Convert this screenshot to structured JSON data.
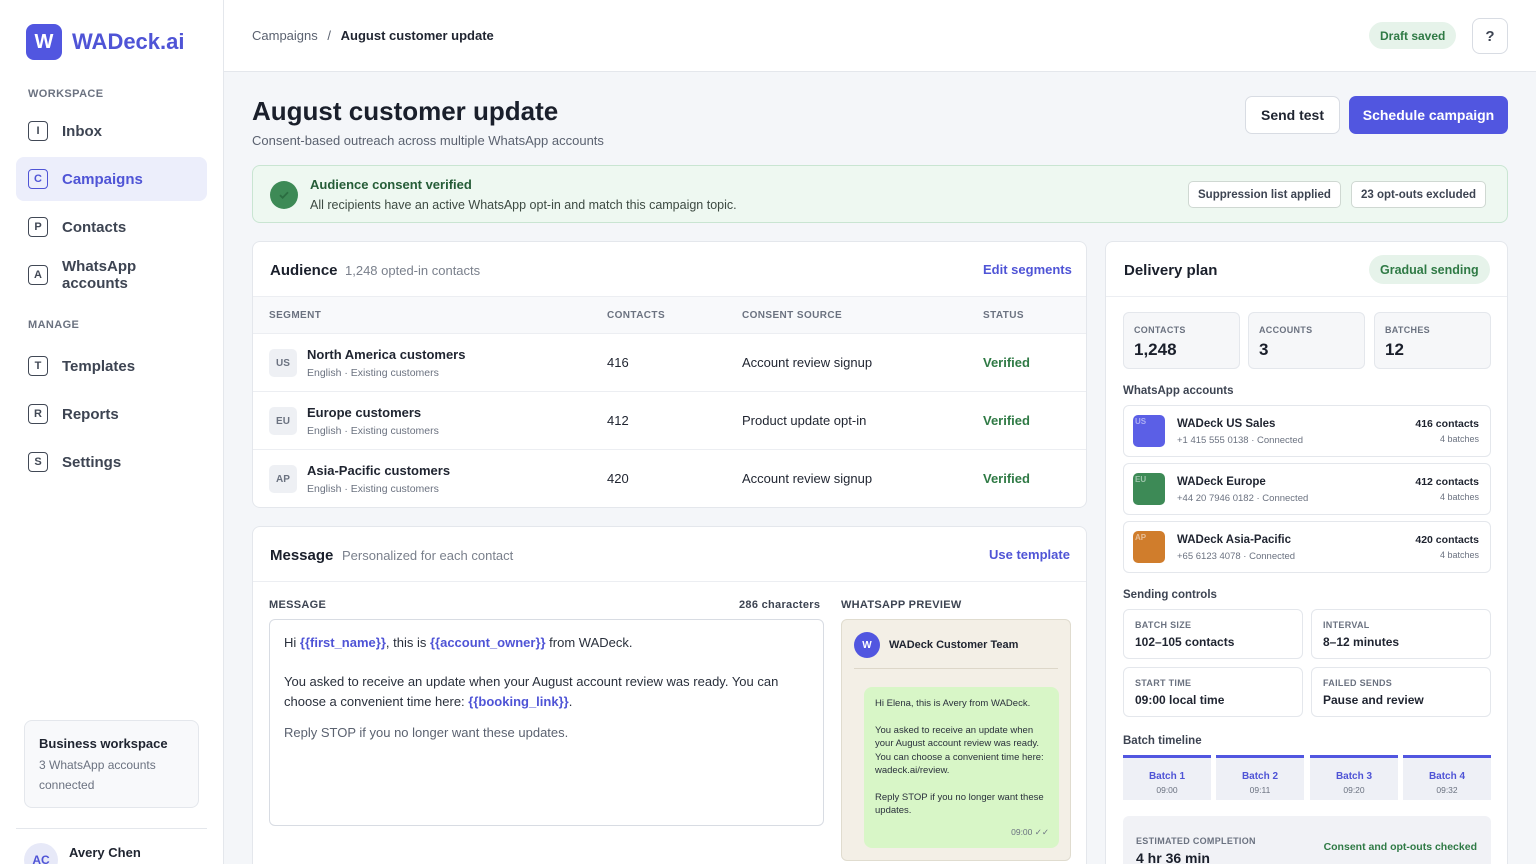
{
  "app": {
    "logo_letter": "W",
    "name": "WADeck.ai",
    "accent": "#5156e0"
  },
  "sidebar": {
    "workspace_heading": "WORKSPACE",
    "manage_heading": "MANAGE",
    "items": [
      {
        "letter": "I",
        "label": "Inbox"
      },
      {
        "letter": "C",
        "label": "Campaigns"
      },
      {
        "letter": "P",
        "label": "Contacts"
      },
      {
        "letter": "A",
        "label": "WhatsApp accounts"
      },
      {
        "letter": "T",
        "label": "Templates"
      },
      {
        "letter": "R",
        "label": "Reports"
      },
      {
        "letter": "S",
        "label": "Settings"
      }
    ],
    "active": "Campaigns",
    "workspace_card": {
      "title": "Business workspace",
      "subtitle": "3 WhatsApp accounts connected"
    },
    "user": {
      "initials": "AC",
      "name": "Avery Chen"
    }
  },
  "topbar": {
    "crumb_parent": "Campaigns",
    "crumb_sep": "/",
    "crumb_current": "August customer update",
    "status": "Draft saved",
    "help": "?"
  },
  "page": {
    "title": "August customer update",
    "subtitle": "Consent-based outreach across multiple WhatsApp accounts",
    "send_test": "Send test",
    "schedule": "Schedule campaign"
  },
  "consent": {
    "title": "Audience consent verified",
    "subtitle": "All recipients have an active WhatsApp opt-in and match this campaign topic.",
    "chip1": "Suppression list applied",
    "chip2": "23 opt-outs excluded"
  },
  "audience": {
    "title": "Audience",
    "subtitle": "1,248 opted-in contacts",
    "edit": "Edit segments",
    "headers": [
      "SEGMENT",
      "CONTACTS",
      "CONSENT SOURCE",
      "STATUS"
    ],
    "rows": [
      {
        "code": "US",
        "name": "North America customers",
        "meta": "English · Existing customers",
        "contacts": "416",
        "source": "Account review signup",
        "status": "Verified"
      },
      {
        "code": "EU",
        "name": "Europe customers",
        "meta": "English · Existing customers",
        "contacts": "412",
        "source": "Product update opt-in",
        "status": "Verified"
      },
      {
        "code": "AP",
        "name": "Asia-Pacific customers",
        "meta": "English · Existing customers",
        "contacts": "420",
        "source": "Account review signup",
        "status": "Verified"
      }
    ]
  },
  "message": {
    "title": "Message",
    "subtitle": "Personalized for each contact",
    "use_template": "Use template",
    "label": "MESSAGE",
    "char_count": "286 characters",
    "preview_label": "WHATSAPP PREVIEW",
    "body": {
      "p1_a": "Hi ",
      "v1": "{{first_name}}",
      "p1_b": ", this is ",
      "v2": "{{account_owner}}",
      "p1_c": " from WADeck.",
      "p2_a": "You asked to receive an update when your August account review was ready. You can choose a convenient time here: ",
      "v3": "{{booking_link}}",
      "p2_b": ".",
      "p3": "Reply STOP if you no longer want these updates."
    },
    "preview": {
      "avatar": "W",
      "sender": "WADeck Customer Team",
      "p1": "Hi Elena, this is Avery from WADeck.",
      "p2": "You asked to receive an update when your August account review was ready. You can choose a convenient time here: wadeck.ai/review.",
      "p3": "Reply STOP if you no longer want these updates.",
      "time": "09:00 ✓✓"
    }
  },
  "delivery": {
    "title": "Delivery plan",
    "mode": "Gradual sending",
    "stats": [
      {
        "label": "CONTACTS",
        "value": "1,248"
      },
      {
        "label": "ACCOUNTS",
        "value": "3"
      },
      {
        "label": "BATCHES",
        "value": "12"
      }
    ],
    "accounts_heading": "WhatsApp accounts",
    "accounts": [
      {
        "code": "US",
        "color": "#5b5fe6",
        "name": "WADeck US Sales",
        "sub": "+1 415 555 0138 · Connected",
        "contacts": "416 contacts",
        "batches": "4 batches"
      },
      {
        "code": "EU",
        "color": "#3d8a56",
        "name": "WADeck Europe",
        "sub": "+44 20 7946 0182 · Connected",
        "contacts": "412 contacts",
        "batches": "4 batches"
      },
      {
        "code": "AP",
        "color": "#d07d2c",
        "name": "WADeck Asia-Pacific",
        "sub": "+65 6123 4078 · Connected",
        "contacts": "420 contacts",
        "batches": "4 batches"
      }
    ],
    "controls_heading": "Sending controls",
    "controls": [
      {
        "label": "BATCH SIZE",
        "value": "102–105 contacts"
      },
      {
        "label": "INTERVAL",
        "value": "8–12 minutes"
      },
      {
        "label": "START TIME",
        "value": "09:00 local time"
      },
      {
        "label": "FAILED SENDS",
        "value": "Pause and review"
      }
    ],
    "timeline_heading": "Batch timeline",
    "batches": [
      {
        "name": "Batch 1",
        "time": "09:00"
      },
      {
        "name": "Batch 2",
        "time": "09:11"
      },
      {
        "name": "Batch 3",
        "time": "09:20"
      },
      {
        "name": "Batch 4",
        "time": "09:32"
      }
    ],
    "estimate_label": "ESTIMATED COMPLETION",
    "estimate_value": "4 hr 36 min",
    "estimate_check": "Consent and opt-outs checked"
  }
}
